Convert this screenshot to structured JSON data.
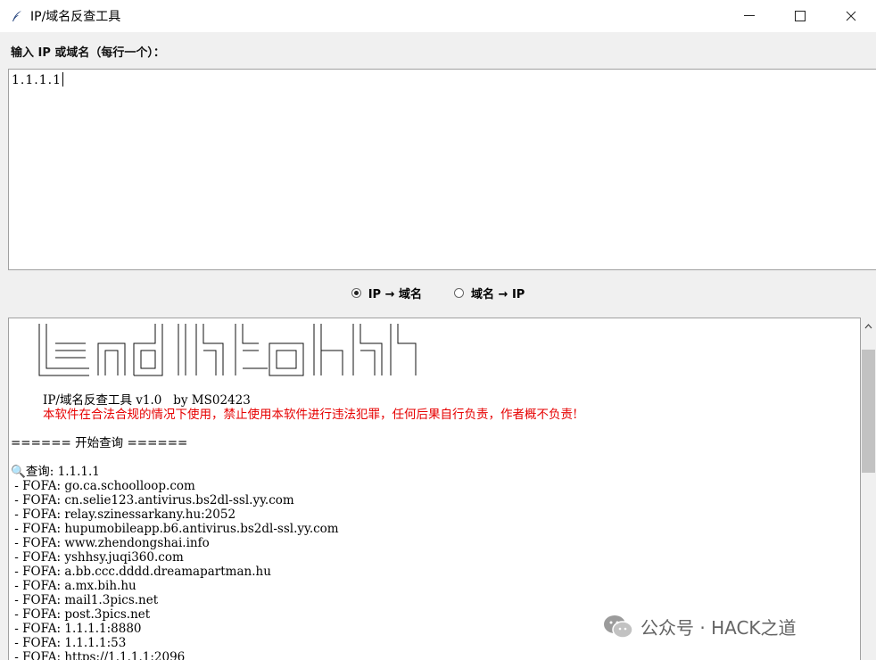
{
  "window": {
    "title": "IP/域名反查工具",
    "minimize": "—",
    "maximize": "☐",
    "close": "✕"
  },
  "input": {
    "label": "输入 IP 或域名（每行一个）：",
    "value": "1.1.1.1"
  },
  "mode": {
    "options": [
      {
        "label": "IP → 域名",
        "checked": true
      },
      {
        "label": "域名 → IP",
        "checked": false
      }
    ]
  },
  "output": {
    "header_line1": "IP/域名反查工具 v1.0   by MS02423",
    "header_line2": "本软件在合法合规的情况下使用，禁止使用本软件进行违法犯罪，任何后果自行负责，作者概不负责!",
    "start": "====== 开始查询 ======",
    "query": "查询: 1.1.1.1",
    "results": [
      " - FOFA: go.ca.schoolloop.com",
      " - FOFA: cn.selie123.antivirus.bs2dl-ssl.yy.com",
      " - FOFA: relay.szinessarkany.hu:2052",
      " - FOFA: hupumobileapp.b6.antivirus.bs2dl-ssl.yy.com",
      " - FOFA: www.zhendongshai.info",
      " - FOFA: yshhsy.juqi360.com",
      " - FOFA: a.bb.ccc.dddd.dreamapartman.hu",
      " - FOFA: a.mx.bih.hu",
      " - FOFA: mail1.3pics.net",
      " - FOFA: post.3pics.net",
      " - FOFA: 1.1.1.1:8880",
      " - FOFA: 1.1.1.1:53",
      " - FOFA: https://1.1.1.1:2096"
    ]
  },
  "watermark": {
    "text": "公众号 · HACK之道",
    "icon": "wechat-icon"
  }
}
